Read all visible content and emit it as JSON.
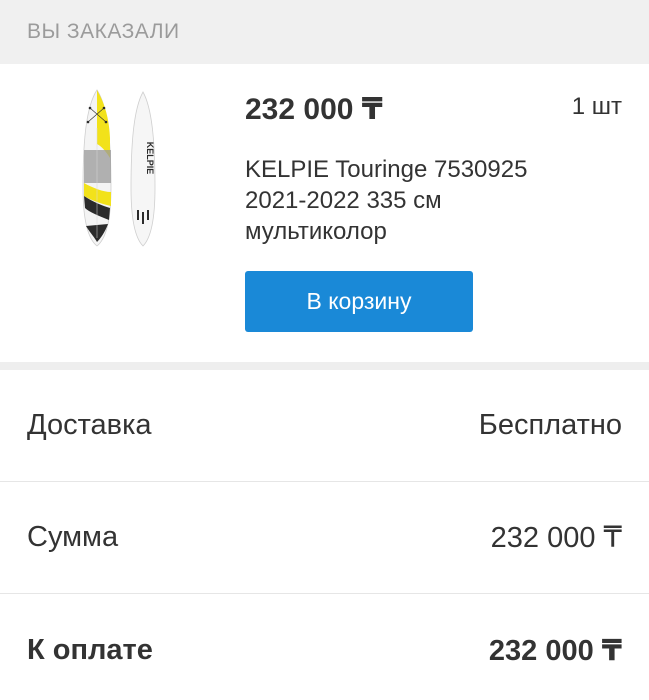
{
  "header": {
    "title": "ВЫ ЗАКАЗАЛИ"
  },
  "product": {
    "price": "232 000 ₸",
    "quantity": "1 шт",
    "title": "KELPIE Touringe 7530925 2021-2022 335 см мультиколор",
    "brand_logo_text": "KELPIE",
    "cart_button_label": "В корзину",
    "image_colors": {
      "board": "#f4f4f4",
      "accent": "#f2e21a",
      "dark": "#2b2b2b",
      "grey": "#9a9a9a"
    }
  },
  "summary": {
    "delivery_label": "Доставка",
    "delivery_value": "Бесплатно",
    "sum_label": "Сумма",
    "sum_value": "232 000 ₸",
    "total_label": "К оплате",
    "total_value": "232 000 ₸"
  },
  "colors": {
    "accent": "#1a89d7",
    "header_bg": "#f0f0f0",
    "text": "#333333",
    "muted": "#9b9b9b"
  }
}
